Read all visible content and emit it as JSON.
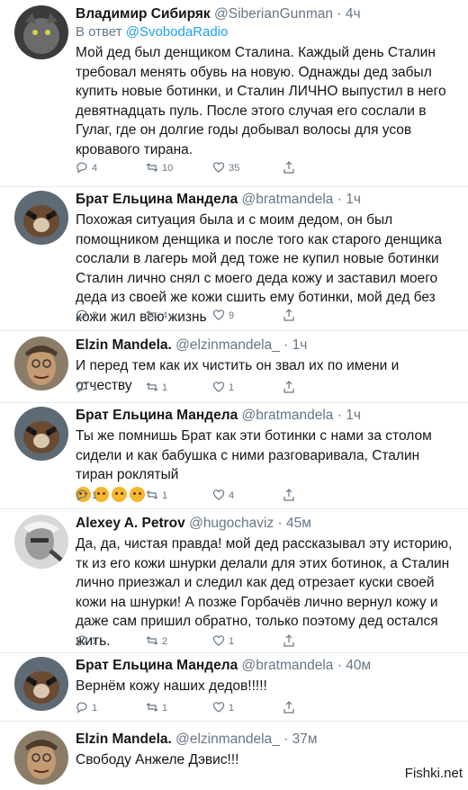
{
  "tweets": [
    {
      "name": "Владимир Сибиряк",
      "handle": "@SiberianGunman",
      "dot": "·",
      "time": "4ч",
      "reply_prefix": "В ответ",
      "reply_to": "@SvobodaRadio",
      "text": "Мой дед был денщиком Сталина. Каждый день Сталин требовал менять обувь на новую. Однажды дед забыл купить новые ботинки, и Сталин ЛИЧНО выпустил в него девятнадцать пуль. После этого случая его сослали в Гулаг, где он долгие годы добывал волосы для усов кровавого тирана.",
      "replies": "4",
      "retweets": "10",
      "likes": "35"
    },
    {
      "name": "Брат Ельцина Мандела",
      "handle": "@bratmandela",
      "dot": "·",
      "time": "1ч",
      "text": "Похожая ситуация была и с моим дедом, он был помощником денщика и после того как старого денщика сослали в лагерь мой дед тоже не купил новые ботинки Сталин лично снял с моего деда кожу и заставил моего деда из своей же кожи сшить ему ботинки, мой дед без кожи жил всю жизнь",
      "replies": "2",
      "retweets": "4",
      "likes": "9"
    },
    {
      "name": "Elzin Mandela.",
      "handle": "@elzinmandela_",
      "dot": "·",
      "time": "1ч",
      "text": "И перед тем как их чистить он звал их по имени и отчеству",
      "replies": "1",
      "retweets": "1",
      "likes": "1"
    },
    {
      "name": "Брат Ельцина Мандела",
      "handle": "@bratmandela",
      "dot": "·",
      "time": "1ч",
      "text": "Ты же помнишь Брат как эти ботинки с нами за столом сидели и как бабушка с ними разговаривала, Сталин тиран роклятый",
      "emoji_count": "4",
      "replies": "1",
      "retweets": "1",
      "likes": "4"
    },
    {
      "name": "Alexey A. Petrov",
      "handle": "@hugochaviz",
      "dot": "·",
      "time": "45м",
      "text": "Да, да, чистая правда! мой дед рассказывал эту историю, тк из его кожи шнурки делали для этих ботинок, а Сталин лично приезжал и следил как дед отрезает куски своей кожи на шнурки! А позже Горбачёв лично вернул кожу и даже сам пришил обратно, только поэтому дед остался жить.",
      "replies": "1",
      "retweets": "2",
      "likes": "1"
    },
    {
      "name": "Брат Ельцина Мандела",
      "handle": "@bratmandela",
      "dot": "·",
      "time": "40м",
      "text": "Вернём кожу наших дедов!!!!!",
      "replies": "1",
      "retweets": "1",
      "likes": "1"
    },
    {
      "name": "Elzin Mandela.",
      "handle": "@elzinmandela_",
      "dot": "·",
      "time": "37м",
      "text": "Свободу Анжеле Дэвис!!!"
    }
  ],
  "watermark": "Fishki.net",
  "icons": {
    "reply": "reply-icon",
    "retweet": "retweet-icon",
    "like": "heart-icon",
    "share": "share-icon"
  },
  "colors": {
    "link": "#1da1f2",
    "muted": "#657786",
    "text": "#14171a",
    "divider": "#e6ecf0"
  }
}
